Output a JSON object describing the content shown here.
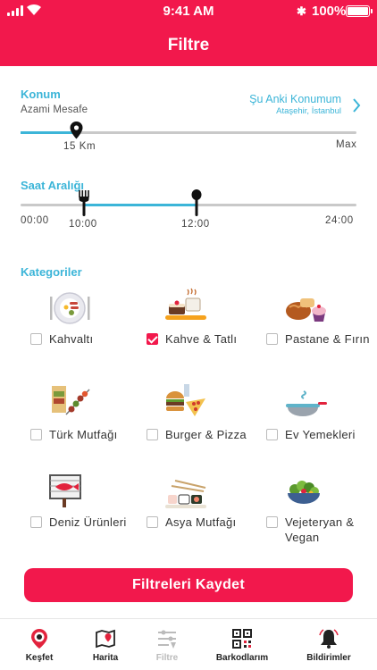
{
  "status_bar": {
    "time": "9:41 AM",
    "battery": "100%"
  },
  "header": {
    "title": "Filtre"
  },
  "location": {
    "section_title": "Konum",
    "distance_label": "Azami Mesafe",
    "current_location_label": "Şu Anki Konumum",
    "current_location_value": "Ataşehir, İstanbul",
    "distance_value": "15 Km",
    "max_label": "Max"
  },
  "time_range": {
    "section_title": "Saat Aralığı",
    "min_label": "00:00",
    "start_value": "10:00",
    "end_value": "12:00",
    "max_label": "24:00"
  },
  "categories": {
    "section_title": "Kategoriler",
    "items": [
      {
        "label": "Kahvaltı",
        "checked": false
      },
      {
        "label": "Kahve & Tatlı",
        "checked": true
      },
      {
        "label": "Pastane & Fırın",
        "checked": false
      },
      {
        "label": "Türk Mutfağı",
        "checked": false
      },
      {
        "label": "Burger & Pizza",
        "checked": false
      },
      {
        "label": "Ev Yemekleri",
        "checked": false
      },
      {
        "label": "Deniz Ürünleri",
        "checked": false
      },
      {
        "label": "Asya Mutfağı",
        "checked": false
      },
      {
        "label": "Vejeteryan & Vegan",
        "checked": false
      }
    ]
  },
  "save_button": {
    "label": "Filtreleri Kaydet"
  },
  "tabbar": {
    "items": [
      {
        "label": "Keşfet",
        "icon": "discover-icon"
      },
      {
        "label": "Harita",
        "icon": "map-icon"
      },
      {
        "label": "Filtre",
        "icon": "filter-icon",
        "active": true
      },
      {
        "label": "Barkodlarım",
        "icon": "qr-code-icon"
      },
      {
        "label": "Bildirimler",
        "icon": "bell-icon"
      }
    ]
  },
  "colors": {
    "primary": "#f2184c",
    "accent": "#3cb5d8"
  }
}
